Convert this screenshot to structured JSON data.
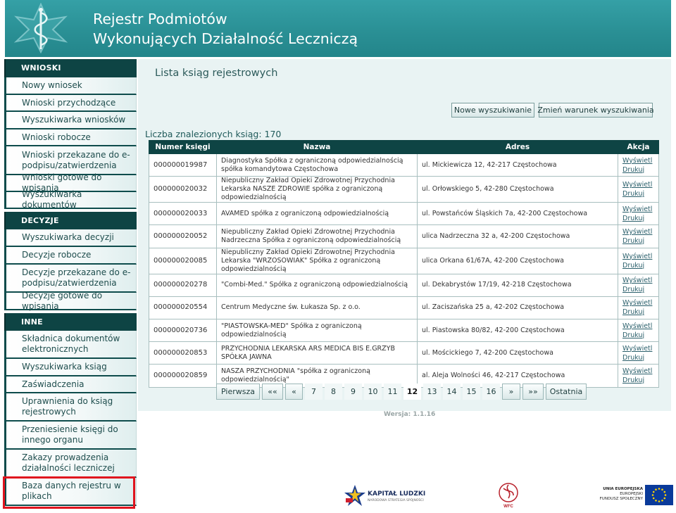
{
  "header": {
    "title_line1": "Rejestr Podmiotów",
    "title_line2": "Wykonujących Działalność Leczniczą"
  },
  "sidebar": {
    "sections": [
      {
        "title": "WNIOSKI",
        "items": [
          "Nowy wniosek",
          "Wnioski przychodzące",
          "Wyszukiwarka wniosków",
          "Wnioski robocze",
          "Wnioski przekazane do e-podpisu/zatwierdzenia",
          "Wnioski gotowe do wpisania",
          "Wyszukiwarka dokumentów"
        ]
      },
      {
        "title": "DECYZJE",
        "items": [
          "Wyszukiwarka decyzji",
          "Decyzje robocze",
          "Decyzje przekazane do e-podpisu/zatwierdzenia",
          "Decyzje gotowe do wpisania"
        ]
      },
      {
        "title": "INNE",
        "items": [
          "Składnica dokumentów elektronicznych",
          "Wyszukiwarka ksiąg",
          "Zaświadczenia",
          "Uprawnienia do ksiąg rejestrowych",
          "Przeniesienie księgi do innego organu",
          "Zakazy prowadzenia działalności leczniczej",
          "Baza danych rejestru w plikach"
        ]
      }
    ]
  },
  "main": {
    "heading": "Lista ksiąg rejestrowych",
    "new_search_label": "Nowe wyszukiwanie",
    "change_search_label": "Zmień warunek wyszukiwania",
    "count_label": "Liczba znalezionych ksiąg: 170",
    "table": {
      "columns": [
        "Numer księgi",
        "Nazwa",
        "Adres",
        "Akcja"
      ],
      "action_view": "Wyświetl",
      "action_print": "Drukuj",
      "rows": [
        {
          "number": "000000019987",
          "name": "Diagnostyka Spółka z ograniczoną odpowiedzialnością spółka komandytowa Częstochowa",
          "address": "ul. Mickiewicza 12, 42-217 Częstochowa"
        },
        {
          "number": "000000020032",
          "name": "Niepubliczny Zakład Opieki Zdrowotnej Przychodnia Lekarska NASZE ZDROWIE spółka z ograniczoną odpowiedzialnością",
          "address": "ul. Orłowskiego 5, 42-280 Częstochowa"
        },
        {
          "number": "000000020033",
          "name": "AVAMED spółka z ograniczoną odpowiedzialnością",
          "address": "ul. Powstańców Śląskich 7a, 42-200 Częstochowa"
        },
        {
          "number": "000000020052",
          "name": "Niepubliczny Zakład Opieki Zdrowotnej Przychodnia Nadrzeczna Spółka z ograniczoną odpowiedzialnością",
          "address": "ulica Nadrzeczna 32 a, 42-200 Częstochowa"
        },
        {
          "number": "000000020085",
          "name": "Niepubliczny Zakład Opieki Zdrowotnej Przychodnia Lekarska \"WRZOSOWIAK\" Spółka z ograniczoną odpowiedzialnością",
          "address": "ulica Orkana 61/67A, 42-200 Częstochowa"
        },
        {
          "number": "000000020278",
          "name": "\"Combi-Med.\" Spółka z ograniczoną odpowiedzialnością",
          "address": "ul. Dekabrystów 17/19, 42-218 Częstochowa"
        },
        {
          "number": "000000020554",
          "name": "Centrum Medyczne św. Łukasza Sp. z o.o.",
          "address": "ul. Zaciszańska 25 a, 42-202 Częstochowa"
        },
        {
          "number": "000000020736",
          "name": "\"PIASTOWSKA-MED\" Spółka z ograniczoną odpowiedzialnością",
          "address": "ul. Piastowska 80/82, 42-200 Częstochowa"
        },
        {
          "number": "000000020853",
          "name": "PRZYCHODNIA LEKARSKA ARS MEDICA BIS E.GRZYB SPÓŁKA JAWNA",
          "address": "ul. Mościckiego 7, 42-200 Częstochowa"
        },
        {
          "number": "000000020859",
          "name": "NASZA PRZYCHODNIA \"spółka z ograniczoną odpowiedzialnością\"",
          "address": "al. Aleja Wolności 46, 42-217 Częstochowa"
        }
      ]
    },
    "pager": {
      "first": "Pierwsza",
      "prev_fast": "««",
      "prev": "«",
      "pages": [
        "7",
        "8",
        "9",
        "10",
        "11",
        "12",
        "13",
        "14",
        "15",
        "16"
      ],
      "current": "12",
      "next": "»",
      "next_fast": "»»",
      "last": "Ostatnia"
    },
    "version": "Wersja: 1.1.16"
  },
  "footer": {
    "kl_title": "KAPITAŁ LUDZKI",
    "kl_subtitle": "NARODOWA STRATEGIA SPÓJNOŚCI",
    "wfc_label": "WFC",
    "eu_line1": "UNIA EUROPEJSKA",
    "eu_line2": "EUROPEJSKI",
    "eu_line3": "FUNDUSZ SPOŁECZNY"
  },
  "colors": {
    "header_teal": "#2a9095",
    "sidebar_dark": "#0e4444",
    "highlight_red": "#e0141e",
    "content_bg": "#e9f3f3"
  }
}
